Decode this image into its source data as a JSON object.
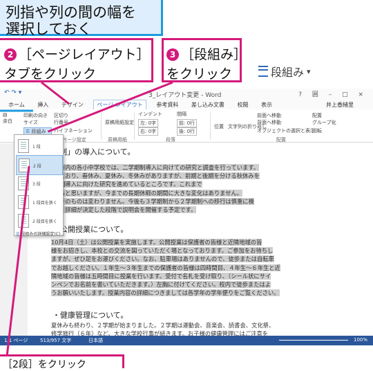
{
  "callout_top": {
    "text": "列指や列の間の幅を\n選択しておく"
  },
  "callout_step2": {
    "number": "2",
    "line1": "［ページレイアウト］",
    "line2": "タブをクリック"
  },
  "callout_step3": {
    "number": "3",
    "line1": "［段組み］",
    "line2": "をクリック"
  },
  "zoom_button": {
    "label": "段組み",
    "arrow": "▾",
    "icon": "columns-icon"
  },
  "callout_bottom": {
    "text": "［2段］をクリック"
  },
  "window": {
    "title": "3_レイアウト変更 - Word",
    "window_controls": "? 囲 – □ ×"
  },
  "tabs": [
    "ホーム",
    "挿入",
    "デザイン",
    "ページ レイアウト",
    "参考資料",
    "差し込み文書",
    "校閲",
    "表示"
  ],
  "active_tab": "ページ レイアウト",
  "user": "井上香緒里",
  "ribbon": {
    "margins": "余白",
    "orientation": "印刷の向き",
    "size": "サイズ",
    "columns": "段組み",
    "breaks": "区切り",
    "line_numbers": "行番号",
    "hyphenation": "ハイフネーション",
    "manuscript": "原稿用紙設定",
    "indent_title": "インデント",
    "indent_left": "左: 0字",
    "indent_right": "右: 0字",
    "spacing_title": "間隔",
    "spacing_before": "前: 0行",
    "spacing_after": "後: 0行",
    "position": "位置",
    "wrap": "文字列の折り返し",
    "forward": "前面へ移動",
    "backward": "背面へ移動",
    "selection_pane": "オブジェクトの選択と表示",
    "align": "配置",
    "group": "グループ化",
    "rotate": "回転",
    "group_labels": [
      "ページ設定",
      "原稿用紙",
      "段落",
      "配置"
    ]
  },
  "dropdown": {
    "items": [
      "1 段",
      "2 段",
      "3 段",
      "1 段目を狭く",
      "2 段目を狭く"
    ],
    "selected_index": 1,
    "footer": "段組みの詳細設定(C)..."
  },
  "document": {
    "heading1": "制」の導入について。",
    "para1": [
      "市内の各小中学校では、二学期制導入に向けての研究と調査を行っています。",
      "とおり、春休み、夏休み、冬休みがありますが、前期と後期を分ける秋休みを",
      "制導入に向けた研究を進めているところです。これまで",
      "ると思いますが、今までの長期休暇の期間に大きな変化はありません。",
      "そのものは変わりません。今後も３学期制から２学期制への移行は慎重に検",
      "、詳細が決定した段階で説明会を開催する予定です。"
    ],
    "heading2": "・公開授業について。",
    "para2": [
      "10月4日（土）は公開授業を実施します。公開授業は保護者の皆様と近隣地域の皆",
      "様をお招きし、本校との交流を図っていただく場となっております。ご参加をお待ちし",
      "ますが、ぜひ足をお運びください。なお、駐車場はありませんので、徒歩または自転車",
      "でお越しください。１年生～３年生までの保護者の皆様は四時間目、４年生～６年生と近",
      "隣地域の皆様は五時間目に授業を行います。受付で名札を受け取り、（シール状にサイ",
      "ンペンでお名前を書いていただきます。）左胸に付けてください。校内で徒歩またはよ",
      "うお願いいたします。授業内容の詳細につきましては各学年の学年便りをご覧ください。"
    ],
    "heading3": "・健康管理について。",
    "para3": [
      "夏休みも終わり、２学期が始まりました。２学期は運動会、音楽会、読書会、文化祭、",
      "修学旅行（６年）など、大きな学校行事が続きます。お子様の健康管理にはご注意を"
    ]
  },
  "statusbar": {
    "page": "1/1 ページ",
    "words": "513/957 文字",
    "lang": "日本語",
    "zoom": "100%"
  }
}
